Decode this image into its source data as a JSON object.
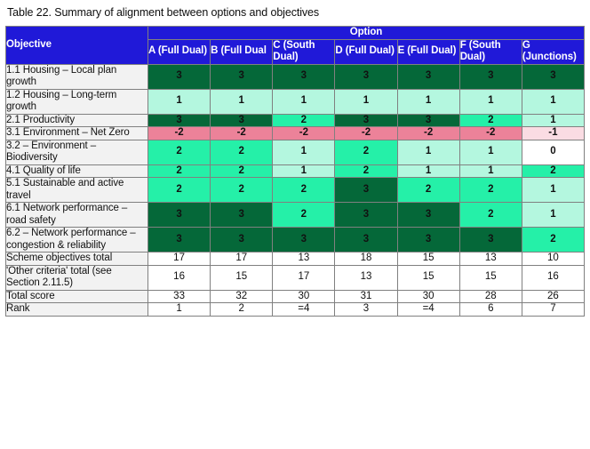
{
  "caption": "Table 22. Summary of alignment between options and objectives",
  "table": {
    "objective_header": "Objective",
    "option_group_header": "Option",
    "columns": [
      {
        "id": "A",
        "label": "A (Full Dual)"
      },
      {
        "id": "B",
        "label": "B (Full Dual"
      },
      {
        "id": "C",
        "label": "C (South Dual)"
      },
      {
        "id": "D",
        "label": "D (Full Dual)"
      },
      {
        "id": "E",
        "label": "E (Full Dual)"
      },
      {
        "id": "F",
        "label": "F (South Dual)"
      },
      {
        "id": "G",
        "label": "G (Junctions)"
      }
    ],
    "rows": [
      {
        "objective": "1.1 Housing – Local plan growth",
        "values": [
          "3",
          "3",
          "3",
          "3",
          "3",
          "3",
          "3"
        ],
        "scores": [
          3,
          3,
          3,
          3,
          3,
          3,
          3
        ]
      },
      {
        "objective": "1.2 Housing – Long-term growth",
        "values": [
          "1",
          "1",
          "1",
          "1",
          "1",
          "1",
          "1"
        ],
        "scores": [
          1,
          1,
          1,
          1,
          1,
          1,
          1
        ]
      },
      {
        "objective": "2.1 Productivity",
        "values": [
          "3",
          "3",
          "2",
          "3",
          "3",
          "2",
          "1"
        ],
        "scores": [
          3,
          3,
          2,
          3,
          3,
          2,
          1
        ]
      },
      {
        "objective": "3.1 Environment – Net Zero",
        "values": [
          "-2",
          "-2",
          "-2",
          "-2",
          "-2",
          "-2",
          "-1"
        ],
        "scores": [
          -2,
          -2,
          -2,
          -2,
          -2,
          -2,
          -1
        ]
      },
      {
        "objective": "3.2 – Environment – Biodiversity",
        "values": [
          "2",
          "2",
          "1",
          "2",
          "1",
          "1",
          "0"
        ],
        "scores": [
          2,
          2,
          1,
          2,
          1,
          1,
          0
        ]
      },
      {
        "objective": "4.1 Quality of life",
        "values": [
          "2",
          "2",
          "1",
          "2",
          "1",
          "1",
          "2"
        ],
        "scores": [
          2,
          2,
          1,
          2,
          1,
          1,
          2
        ]
      },
      {
        "objective": "5.1 Sustainable and active travel",
        "values": [
          "2",
          "2",
          "2",
          "3",
          "2",
          "2",
          "1"
        ],
        "scores": [
          2,
          2,
          2,
          3,
          2,
          2,
          1
        ]
      },
      {
        "objective": "6.1 Network performance – road safety",
        "values": [
          "3",
          "3",
          "2",
          "3",
          "3",
          "2",
          "1"
        ],
        "scores": [
          3,
          3,
          2,
          3,
          3,
          2,
          1
        ]
      },
      {
        "objective": "6.2 – Network performance – congestion & reliability",
        "values": [
          "3",
          "3",
          "3",
          "3",
          "3",
          "3",
          "2"
        ],
        "scores": [
          3,
          3,
          3,
          3,
          3,
          3,
          2
        ]
      }
    ],
    "summary_rows": [
      {
        "objective": "Scheme objectives total",
        "values": [
          "17",
          "17",
          "13",
          "18",
          "15",
          "13",
          "10"
        ]
      },
      {
        "objective": "'Other criteria' total (see Section 2.11.5)",
        "values": [
          "16",
          "15",
          "17",
          "13",
          "15",
          "15",
          "16"
        ]
      },
      {
        "objective": "Total score",
        "values": [
          "33",
          "32",
          "30",
          "31",
          "30",
          "28",
          "26"
        ]
      },
      {
        "objective": "Rank",
        "values": [
          "1",
          "2",
          "=4",
          "3",
          "=4",
          "6",
          "7"
        ]
      }
    ]
  },
  "colors": {
    "header_blue": "#2019D8",
    "score_3": "#056839",
    "score_2": "#25F0A8",
    "score_1": "#B4F7DF",
    "score_0": "#FFFFFF",
    "score_minus_1": "#FADCE3",
    "score_minus_2": "#EC8299",
    "objective_cell": "#F2F2F2",
    "border": "#808080"
  }
}
